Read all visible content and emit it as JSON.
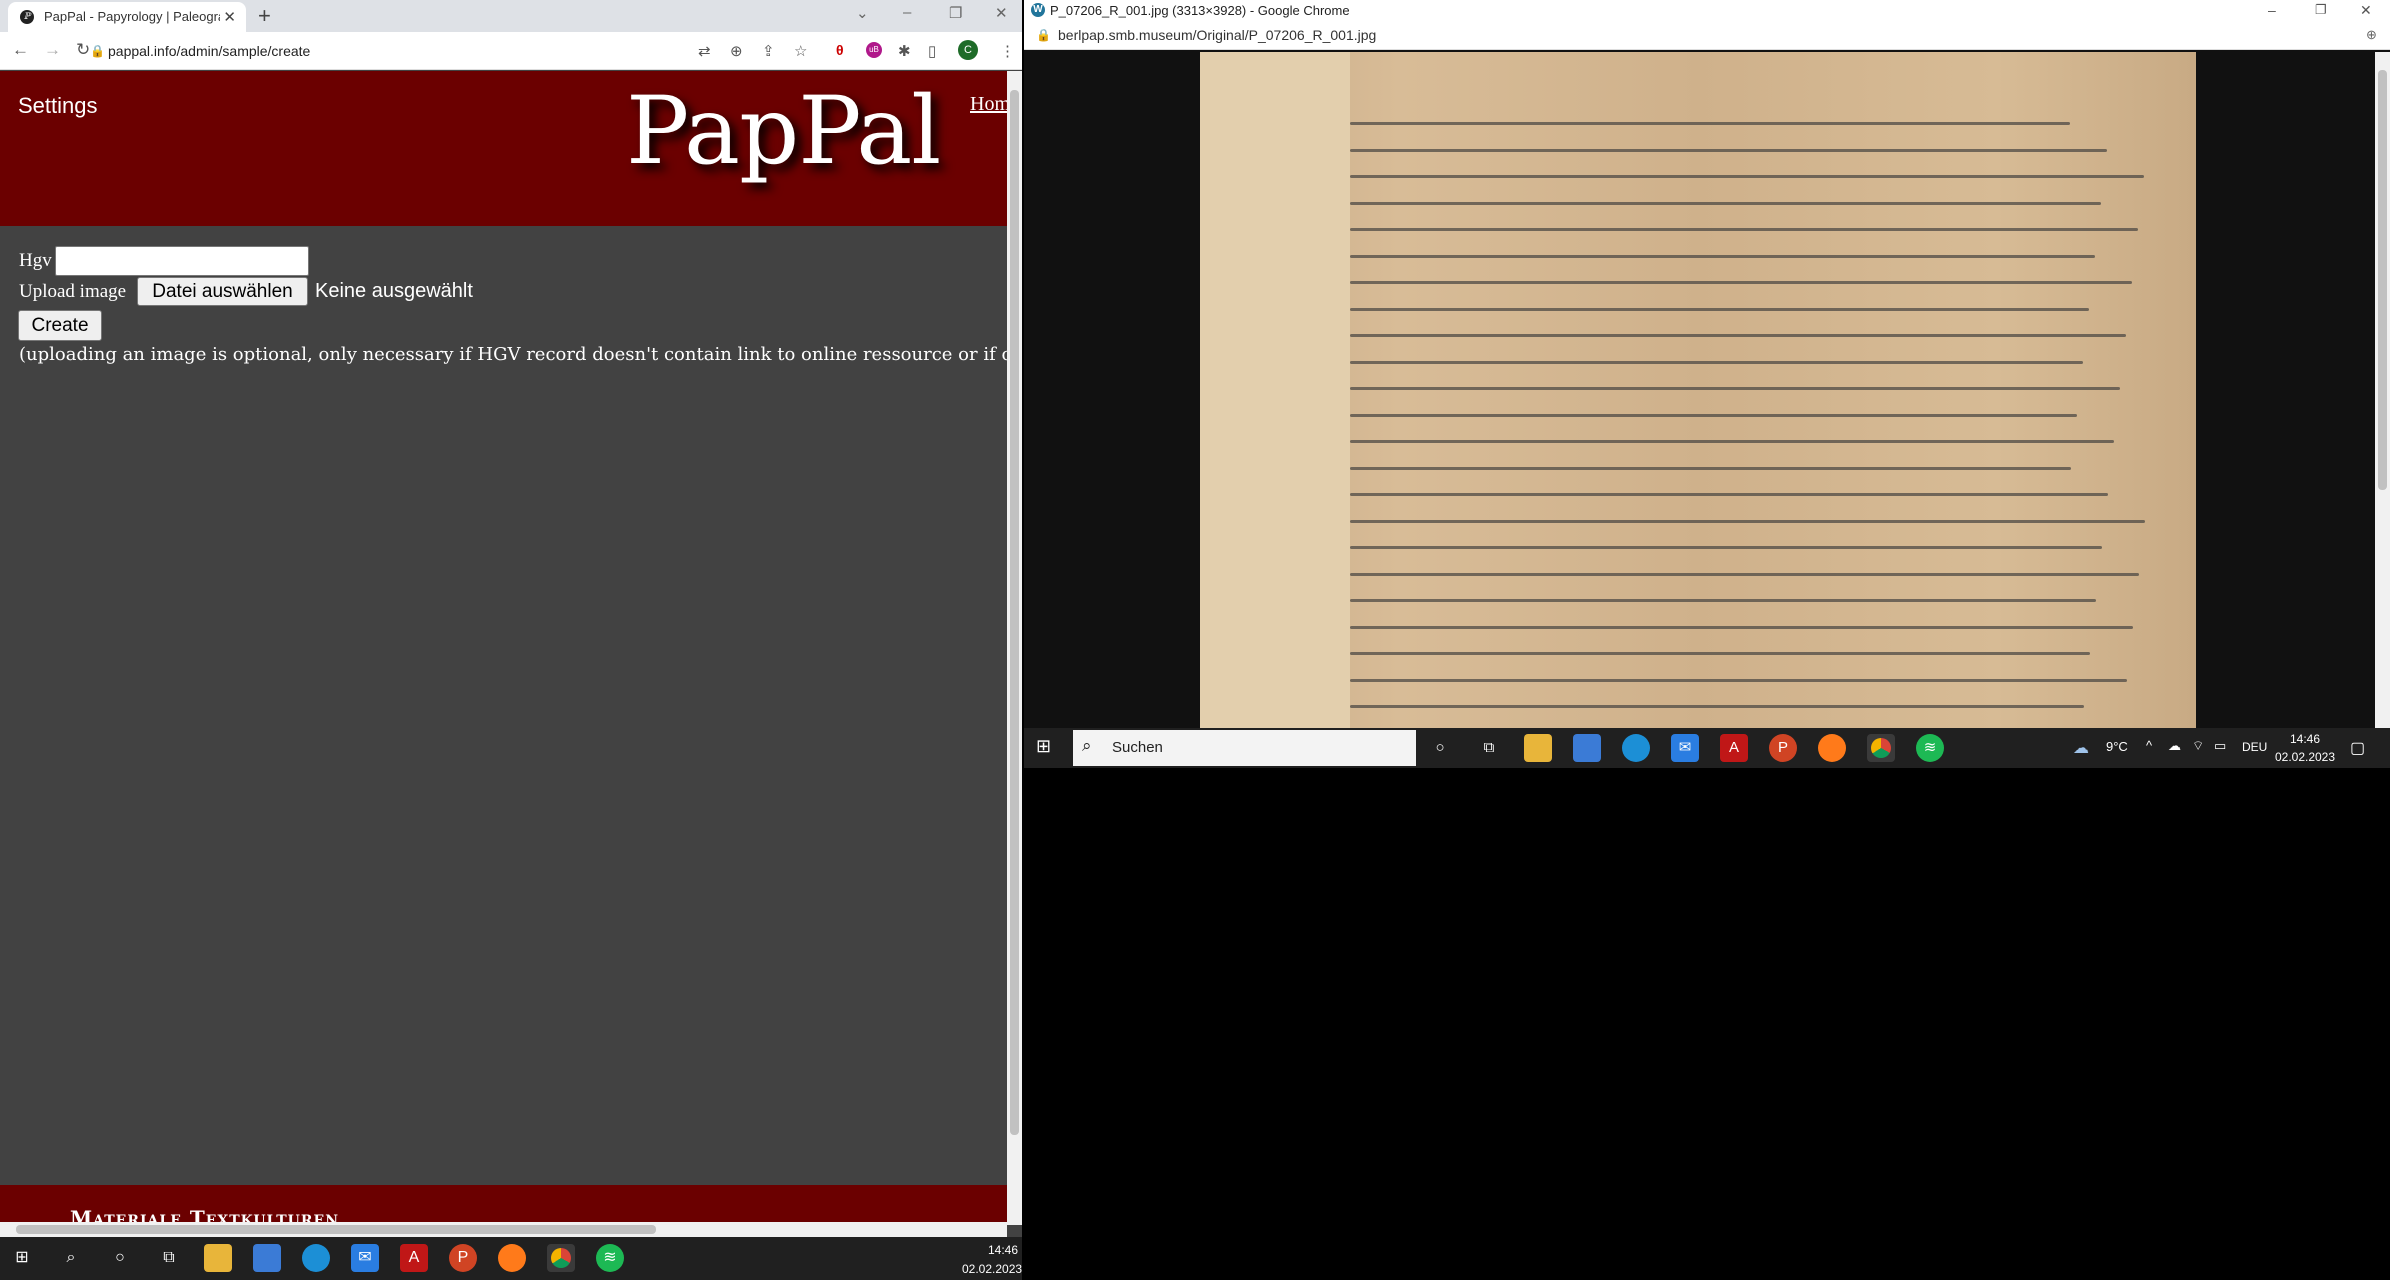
{
  "left_window": {
    "tab_title": "PapPal - Papyrology | Paleograph",
    "url": "pappal.info/admin/sample/create",
    "profile_initial": "C",
    "window_controls": [
      "⌄",
      "–",
      "❐",
      "✕"
    ],
    "toolbar_icons": [
      "translate-icon",
      "zoom-icon",
      "share-icon",
      "star-icon",
      "extension-red-icon",
      "ublock-icon",
      "puzzle-icon",
      "sidepanel-icon",
      "profile-avatar",
      "menu-icon"
    ]
  },
  "page": {
    "settings_label": "Settings",
    "logo": "PapPal",
    "home_link": "Home",
    "hgv_label": "Hgv",
    "hgv_value": "",
    "upload_label": "Upload image",
    "file_button": "Datei auswählen",
    "file_status": "Keine ausgewählt",
    "create_button": "Create",
    "note": "(uploading an image is optional, only necessary if HGV record doesn't contain link to online ressource or if online arc",
    "footer_text": "Materiale Textkulturen"
  },
  "left_taskbar": {
    "time": "14:46",
    "date": "02.02.2023",
    "apps": [
      "windows-start",
      "search",
      "cortana",
      "task-view",
      "file-explorer",
      "ms-store",
      "edge",
      "mail",
      "acrobat",
      "powerpoint",
      "firefox",
      "chrome",
      "spotify"
    ]
  },
  "right_window": {
    "title": "P_07206_R_001.jpg (3313×3928) - Google Chrome",
    "url": "berlpap.smb.museum/Original/P_07206_R_001.jpg"
  },
  "right_taskbar": {
    "search_placeholder": "Suchen",
    "weather": "9°C",
    "language": "DEU",
    "time": "14:46",
    "date": "02.02.2023"
  },
  "colors": {
    "header_red": "#6b0000",
    "page_bg": "#424242",
    "taskbar": "#202020"
  }
}
